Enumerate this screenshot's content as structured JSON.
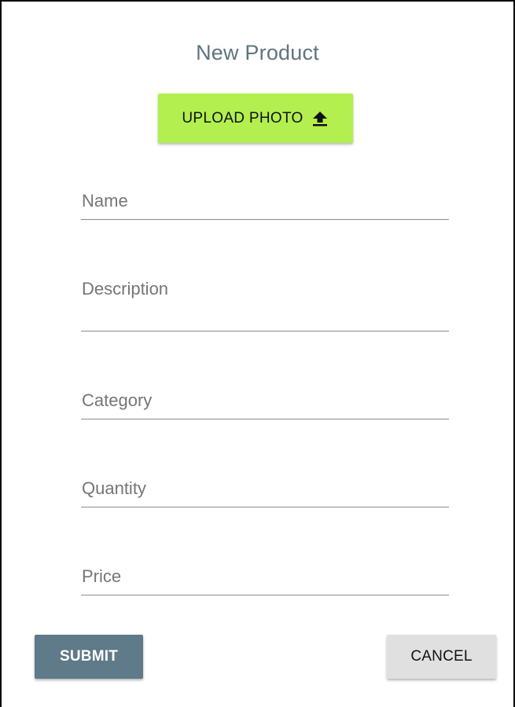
{
  "form": {
    "title": "New Product",
    "upload_button": {
      "label": "UPLOAD PHOTO",
      "icon": "upload-arrow-icon",
      "color": "#b2ef4f"
    },
    "fields": {
      "name": {
        "placeholder": "Name",
        "value": ""
      },
      "description": {
        "placeholder": "Description",
        "value": ""
      },
      "category": {
        "placeholder": "Category",
        "value": ""
      },
      "quantity": {
        "placeholder": "Quantity",
        "value": ""
      },
      "price": {
        "placeholder": "Price",
        "value": ""
      }
    },
    "actions": {
      "submit_label": "SUBMIT",
      "submit_color": "#5f7a89",
      "cancel_label": "CANCEL",
      "cancel_color": "#e0e0e0"
    }
  }
}
